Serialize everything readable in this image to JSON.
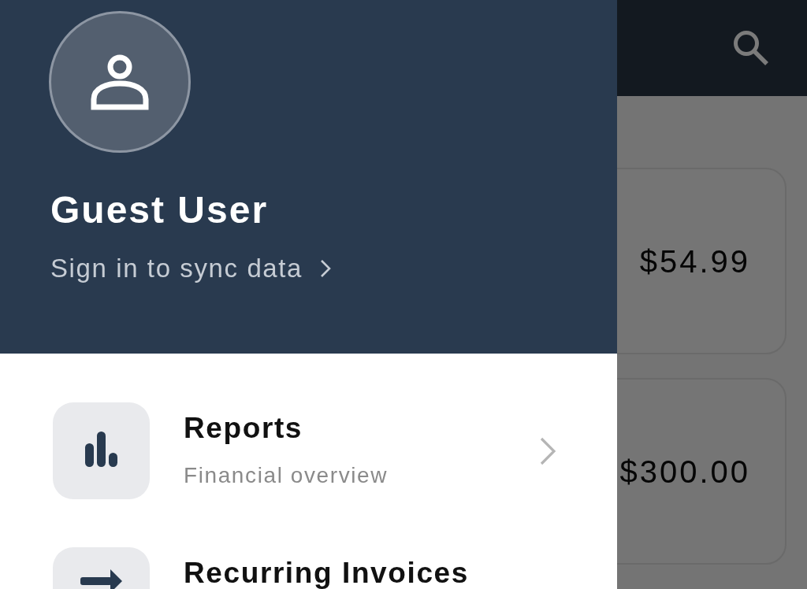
{
  "background_app": {
    "cards": [
      {
        "amount": "$54.99"
      },
      {
        "amount": "$300.00"
      }
    ]
  },
  "drawer": {
    "profile": {
      "name": "Guest User",
      "link": "Sign in to sync data"
    },
    "menu_items": [
      {
        "title": "Reports",
        "subtitle": "Financial overview"
      },
      {
        "title": "Recurring Invoices"
      }
    ]
  }
}
